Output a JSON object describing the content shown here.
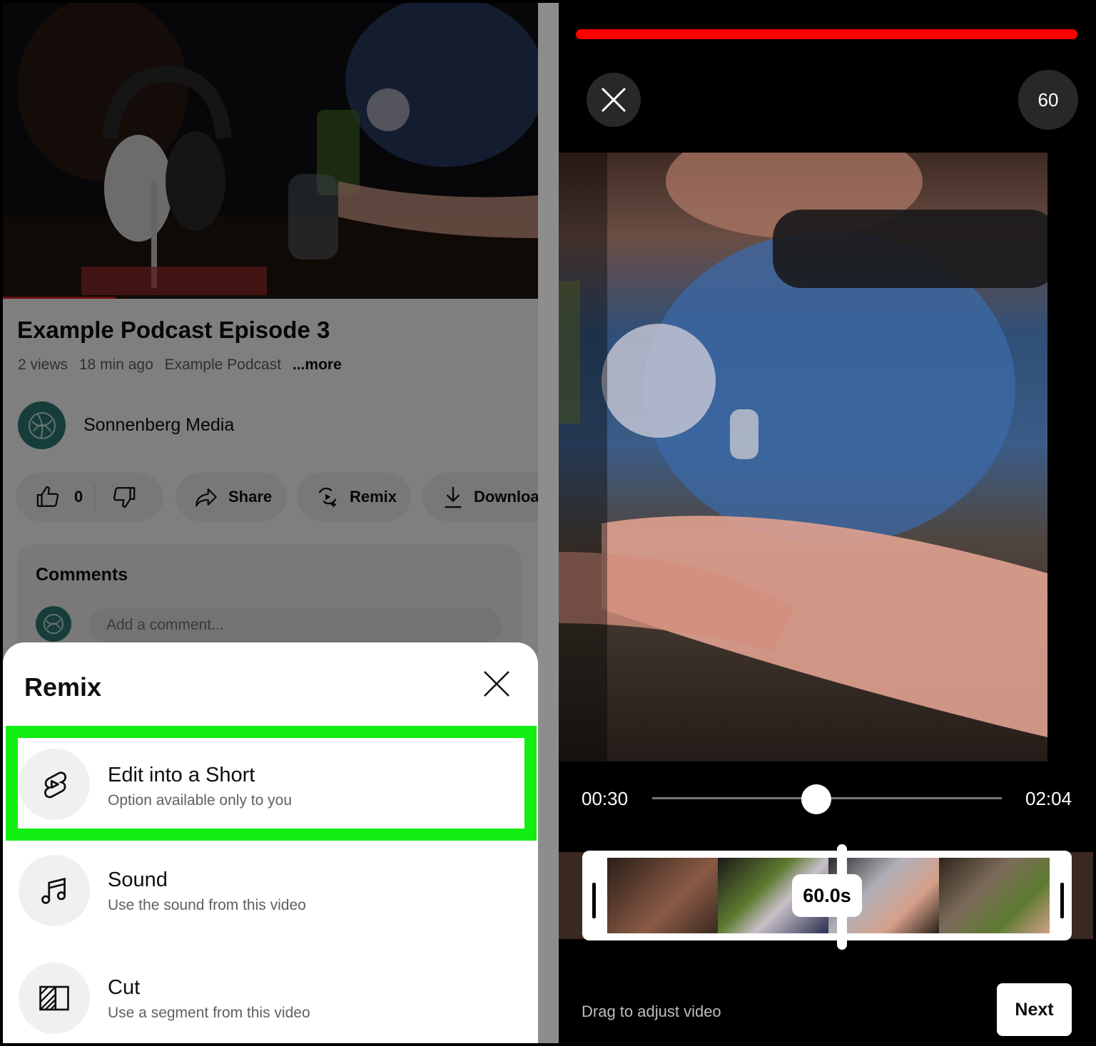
{
  "video": {
    "title": "Example Podcast Episode 3",
    "views": "2 views",
    "age": "18 min ago",
    "channel_tag": "Example Podcast",
    "more": "...more",
    "progress_fraction": 0.21
  },
  "channel": {
    "name": "Sonnenberg Media"
  },
  "actions": {
    "like_count": "0",
    "share_label": "Share",
    "remix_label": "Remix",
    "download_label": "Download"
  },
  "comments": {
    "title": "Comments",
    "placeholder": "Add a comment..."
  },
  "remix_sheet": {
    "title": "Remix",
    "options": [
      {
        "title": "Edit into a Short",
        "subtitle": "Option available only to you",
        "icon": "shorts-icon",
        "highlighted": true
      },
      {
        "title": "Sound",
        "subtitle": "Use the sound from this video",
        "icon": "music-note-icon"
      },
      {
        "title": "Cut",
        "subtitle": "Use a segment from this video",
        "icon": "cut-icon"
      }
    ]
  },
  "editor": {
    "duration_badge": "60",
    "time_start": "00:30",
    "time_end": "02:04",
    "scrubber_fraction": 0.47,
    "selection_label": "60.0s",
    "hint": "Drag to adjust video",
    "next_label": "Next"
  },
  "colors": {
    "highlight": "#11ee11",
    "progress_red": "#ff0000",
    "channel_avatar": "#2c7a72"
  }
}
